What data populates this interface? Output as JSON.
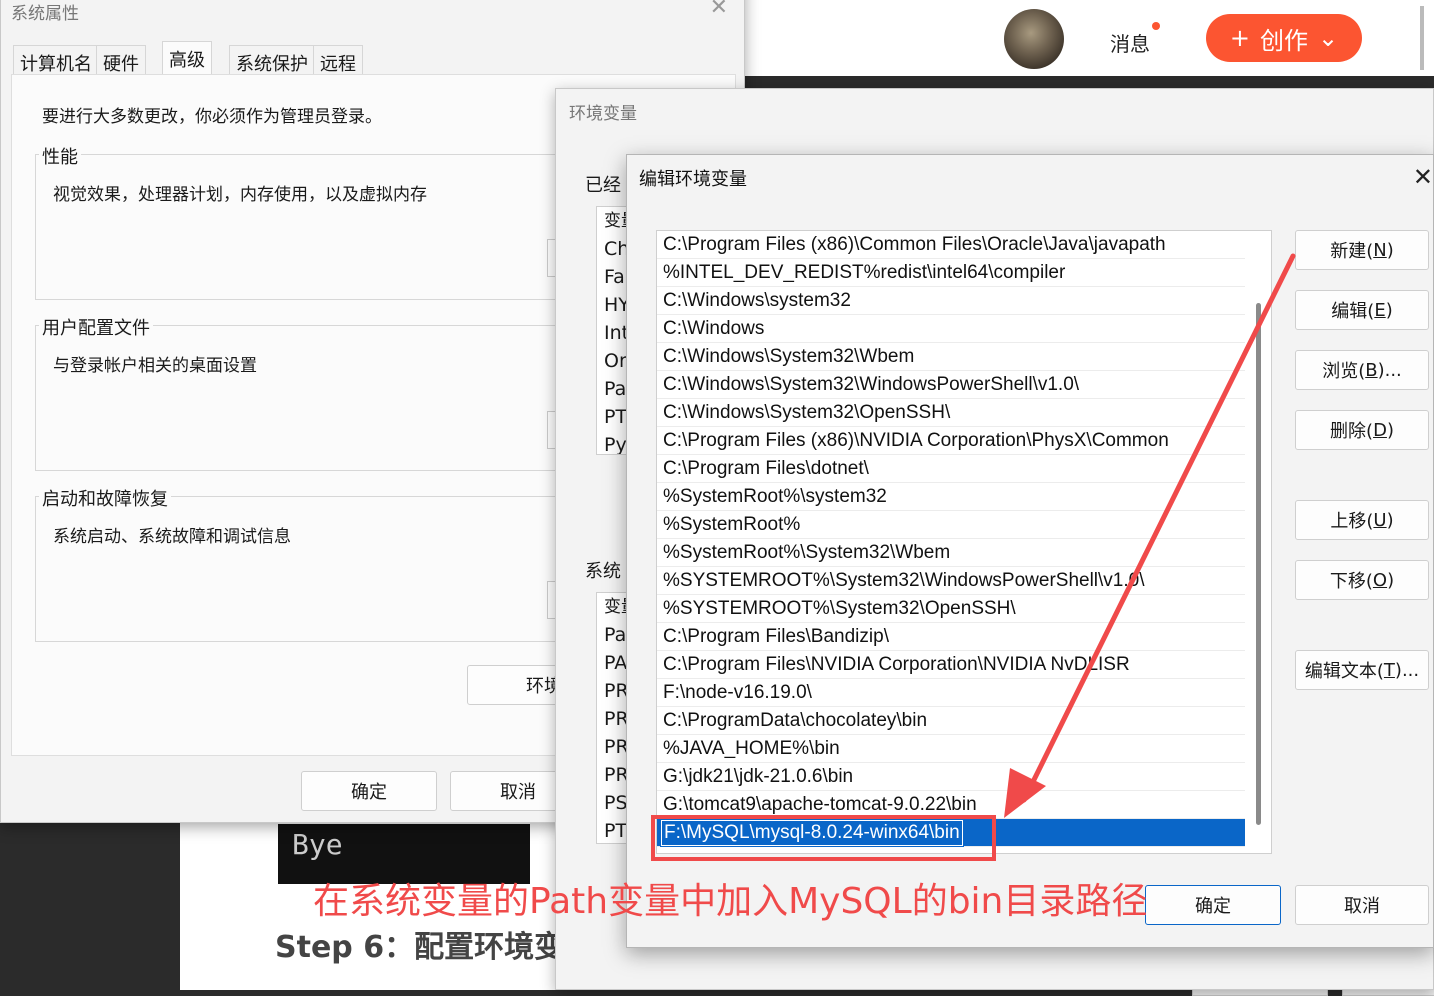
{
  "background_page": {
    "message_label": "消息",
    "create_label": "创作",
    "create_plus": "+",
    "create_chevron": "⌄",
    "terminal_text": "Bye",
    "step_heading": "Step 6：配置环境变",
    "ok_label": "确定",
    "cancel_label": "取消"
  },
  "system_properties": {
    "title": "系统属性",
    "tabs": [
      "计算机名",
      "硬件",
      "高级",
      "系统保护",
      "远程"
    ],
    "active_tab": "高级",
    "admin_notice": "要进行大多数更改，你必须作为管理员登录。",
    "groups": [
      {
        "title": "性能",
        "description": "视觉效果，处理器计划，内存使用，以及虚拟内存"
      },
      {
        "title": "用户配置文件",
        "description": "与登录帐户相关的桌面设置"
      },
      {
        "title": "启动和故障恢复",
        "description": "系统启动、系统故障和调试信息"
      }
    ],
    "env_button_label": "环境",
    "ok_label": "确定",
    "cancel_label": "取消"
  },
  "environment_variables": {
    "title": "环境变量",
    "user_section_label": "已经",
    "system_section_label": "系统",
    "user_rows": [
      "变量",
      "Ch",
      "Fa",
      "HY",
      "Int",
      "On",
      "Pa",
      "PT",
      "Py"
    ],
    "system_rows": [
      "变量",
      "Pa",
      "PA",
      "PR",
      "PR",
      "PR",
      "PR",
      "PS",
      "PT"
    ]
  },
  "edit_dialog": {
    "title": "编辑环境变量",
    "close_glyph": "✕",
    "paths": [
      "C:\\Program Files (x86)\\Common Files\\Oracle\\Java\\javapath",
      "%INTEL_DEV_REDIST%redist\\intel64\\compiler",
      "C:\\Windows\\system32",
      "C:\\Windows",
      "C:\\Windows\\System32\\Wbem",
      "C:\\Windows\\System32\\WindowsPowerShell\\v1.0\\",
      "C:\\Windows\\System32\\OpenSSH\\",
      "C:\\Program Files (x86)\\NVIDIA Corporation\\PhysX\\Common",
      "C:\\Program Files\\dotnet\\",
      "%SystemRoot%\\system32",
      "%SystemRoot%",
      "%SystemRoot%\\System32\\Wbem",
      "%SYSTEMROOT%\\System32\\WindowsPowerShell\\v1.0\\",
      "%SYSTEMROOT%\\System32\\OpenSSH\\",
      "C:\\Program Files\\Bandizip\\",
      "C:\\Program Files\\NVIDIA Corporation\\NVIDIA NvDLISR",
      "F:\\node-v16.19.0\\",
      "C:\\ProgramData\\chocolatey\\bin",
      "%JAVA_HOME%\\bin",
      "G:\\jdk21\\jdk-21.0.6\\bin",
      "G:\\tomcat9\\apache-tomcat-9.0.22\\bin"
    ],
    "editing_value": "F:\\MySQL\\mysql-8.0.24-winx64\\bin",
    "buttons": {
      "new": {
        "text": "新建(",
        "key": "N",
        "tail": ")"
      },
      "edit": {
        "text": "编辑(",
        "key": "E",
        "tail": ")"
      },
      "browse": {
        "text": "浏览(",
        "key": "B",
        "tail": ")..."
      },
      "delete": {
        "text": "删除(",
        "key": "D",
        "tail": ")"
      },
      "move_up": {
        "text": "上移(",
        "key": "U",
        "tail": ")"
      },
      "move_down": {
        "text": "下移(",
        "key": "O",
        "tail": ")"
      },
      "edit_text": {
        "text": "编辑文本(",
        "key": "T",
        "tail": ")..."
      }
    },
    "ok_label": "确定",
    "cancel_label": "取消"
  },
  "annotation": {
    "text": "在系统变量的Path变量中加入MySQL的bin目录路径",
    "color": "#f04a4a"
  },
  "colors": {
    "brand_orange": "#fc5531",
    "selection_blue": "#0a66c8"
  }
}
